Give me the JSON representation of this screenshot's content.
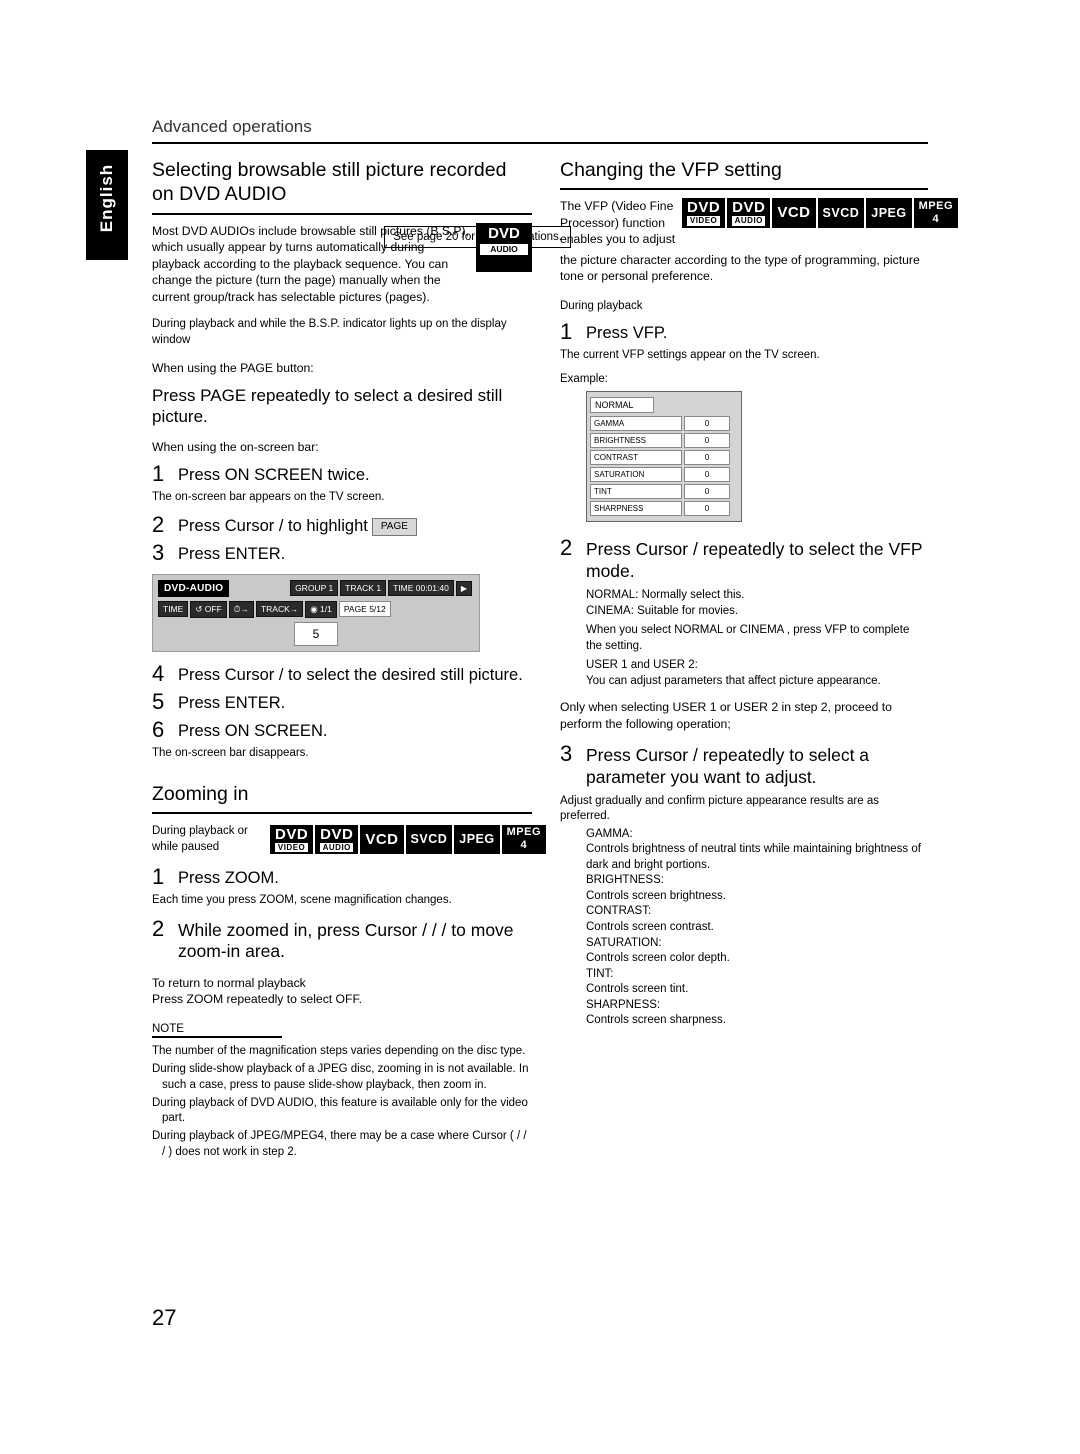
{
  "header": {
    "section": "Advanced operations",
    "see_page_note": "See page 20 for button locations.",
    "language_tab": "English"
  },
  "left": {
    "title": "Selecting browsable still picture recorded on DVD AUDIO",
    "intro": "Most DVD AUDIOs include browsable still pictures (B.S.P), which usually appear by turns automatically during playback according to the playback sequence. You can change the picture (turn the page) manually when the current group/track has selectable pictures (pages).",
    "intro_badge": {
      "line1": "DVD",
      "line2": "AUDIO"
    },
    "cond1": "During playback and while the B.S.P. indicator lights up on the display window",
    "when_page": "When using the PAGE button:",
    "page_instruction": "Press PAGE repeatedly to select a desired still picture.",
    "when_osb": "When using the on-screen bar:",
    "steps": [
      {
        "num": "1",
        "text": "Press ON SCREEN twice.",
        "note": "The on-screen bar appears on the TV screen."
      },
      {
        "num": "2",
        "text": "Press Cursor    /    to highlight",
        "chip": "PAGE"
      },
      {
        "num": "3",
        "text": "Press ENTER."
      },
      {
        "num": "4",
        "text": "Press Cursor    /    to select the desired still picture."
      },
      {
        "num": "5",
        "text": "Press ENTER."
      },
      {
        "num": "6",
        "text": "Press ON SCREEN.",
        "note": "The on-screen bar disappears."
      }
    ],
    "osb_graphic": {
      "label": "DVD-AUDIO",
      "top_cells": [
        "GROUP 1",
        "TRACK 1",
        "TIME  00:01:40"
      ],
      "bottom_cells": [
        "TIME",
        "OFF",
        "TRACK",
        "1/1",
        "PAGE 5/12"
      ],
      "selected_value": "5"
    },
    "zoom": {
      "title": "Zooming in",
      "cond": "During playback or while paused",
      "badges": [
        {
          "line1": "DVD",
          "line2": "VIDEO"
        },
        {
          "line1": "DVD",
          "line2": "AUDIO"
        },
        {
          "line1": "VCD",
          "line2": ""
        },
        {
          "line1": "SVCD",
          "line2": ""
        },
        {
          "line1": "JPEG",
          "line2": ""
        },
        {
          "line1": "MPEG",
          "line2": "4"
        }
      ],
      "steps": [
        {
          "num": "1",
          "text": "Press ZOOM.",
          "note": "Each time you press ZOOM, scene magnification changes."
        },
        {
          "num": "2",
          "text": "While zoomed in, press Cursor    /    /    /    to move zoom-in area."
        }
      ],
      "return_title": "To return to normal playback",
      "return_text": "Press ZOOM repeatedly to select OFF."
    },
    "note": {
      "label": "NOTE",
      "items": [
        "The number of the magnification steps varies depending on the disc type.",
        "During slide-show playback of a JPEG disc, zooming in is not available. In such a case, press      to pause slide-show playback, then zoom in.",
        "During playback of DVD AUDIO, this feature is available only for the video part.",
        "During playback of JPEG/MPEG4, there may be a case where Cursor (    /    /    /    ) does not work in step 2."
      ]
    }
  },
  "right": {
    "title": "Changing the VFP setting",
    "intro_left": "The VFP (Video Fine Processor) function enables you to adjust",
    "intro_rest": "the picture character according to the type of programming, picture tone or personal preference.",
    "badges": [
      {
        "line1": "DVD",
        "line2": "VIDEO"
      },
      {
        "line1": "DVD",
        "line2": "AUDIO"
      },
      {
        "line1": "VCD",
        "line2": ""
      },
      {
        "line1": "SVCD",
        "line2": ""
      },
      {
        "line1": "JPEG",
        "line2": ""
      },
      {
        "line1": "MPEG",
        "line2": "4"
      }
    ],
    "cond": "During playback",
    "step1": {
      "num": "1",
      "text": "Press VFP.",
      "note": "The current VFP settings appear on the TV screen.",
      "example_label": "Example:"
    },
    "vfp_panel": {
      "title": "NORMAL",
      "rows": [
        {
          "name": "GAMMA",
          "value": "0"
        },
        {
          "name": "BRIGHTNESS",
          "value": "0"
        },
        {
          "name": "CONTRAST",
          "value": "0"
        },
        {
          "name": "SATURATION",
          "value": "0"
        },
        {
          "name": "TINT",
          "value": "0"
        },
        {
          "name": "SHARPNESS",
          "value": "0"
        }
      ]
    },
    "step2": {
      "num": "2",
      "text": "Press Cursor      /      repeatedly to select the VFP mode.",
      "lines": [
        "NORMAL: Normally select this.",
        "CINEMA: Suitable for movies.",
        "When you select  NORMAL  or  CINEMA , press VFP to complete the setting.",
        "USER 1 and USER 2:",
        "You can adjust parameters that affect picture appearance."
      ],
      "after": "Only when selecting  USER 1  or  USER 2  in step 2, proceed to perform the following operation;"
    },
    "step3": {
      "num": "3",
      "text": "Press Cursor    /    repeatedly to select a parameter you want to adjust.",
      "note": "Adjust gradually and confirm picture appearance results are as preferred.",
      "params": [
        {
          "name": "GAMMA:",
          "desc": "Controls brightness of neutral tints while maintaining brightness of dark and bright portions."
        },
        {
          "name": "BRIGHTNESS:",
          "desc": "Controls screen brightness."
        },
        {
          "name": "CONTRAST:",
          "desc": "Controls screen contrast."
        },
        {
          "name": "SATURATION:",
          "desc": "Controls screen color depth."
        },
        {
          "name": "TINT:",
          "desc": "Controls screen tint."
        },
        {
          "name": "SHARPNESS:",
          "desc": "Controls screen sharpness."
        }
      ]
    }
  },
  "page_number": "27"
}
